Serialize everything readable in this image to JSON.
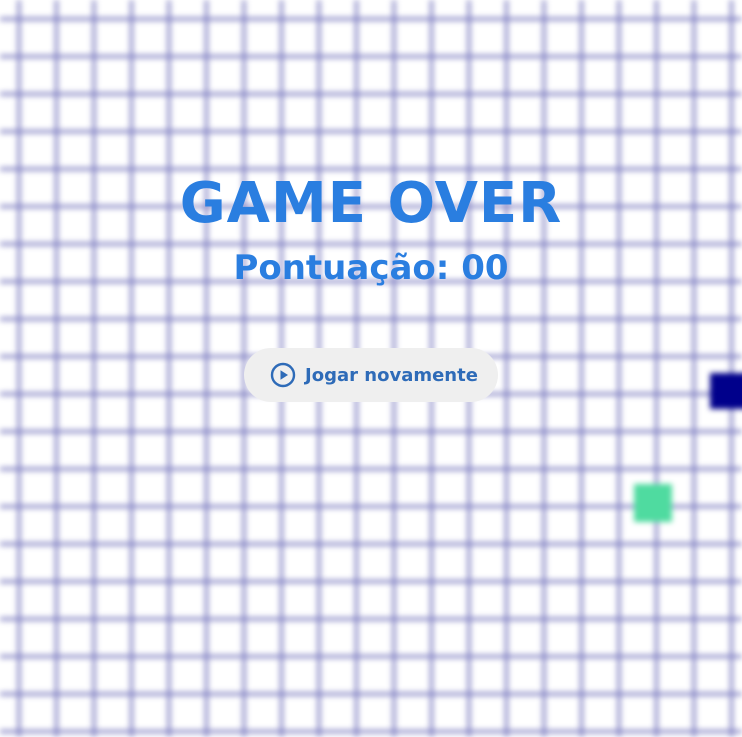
{
  "game": {
    "title": "GAME OVER",
    "score_label": "Pontuação: ",
    "score_value": "00"
  },
  "menu": {
    "play_again_label": "Jogar novamente",
    "play_icon": "play-circle-icon"
  },
  "colors": {
    "title": "#2a7ee0",
    "button_text": "#2e6bb8",
    "button_background": "#efefef",
    "grid_lines": "#7878be",
    "snake": "#00008b",
    "food": "#4fdba0"
  }
}
